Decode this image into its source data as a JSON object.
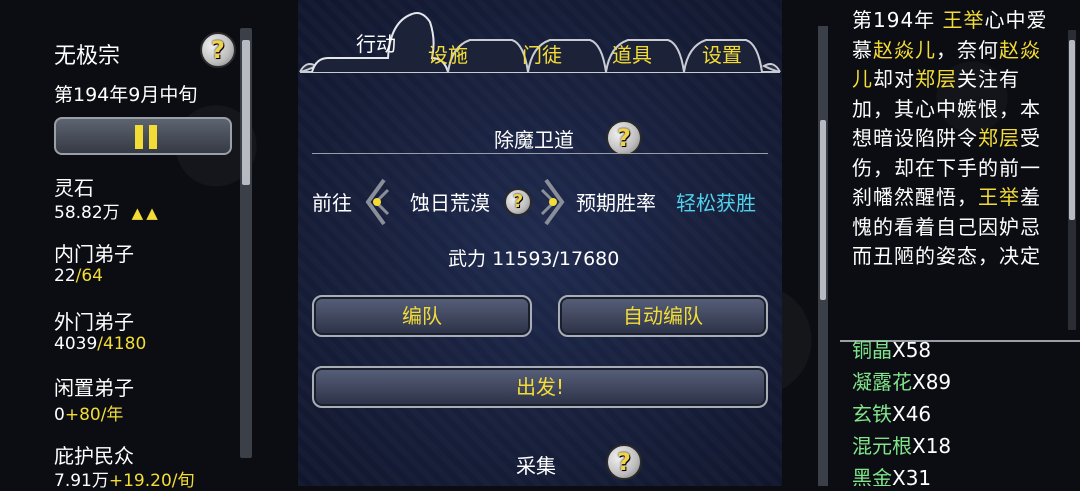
{
  "sect": {
    "name": "无极宗",
    "date": "第194年9月中旬"
  },
  "help_glyph": "?",
  "stats": {
    "spirit_stones": {
      "label": "灵石",
      "value": "58.82万",
      "trend": "▲▲"
    },
    "inner_disciples": {
      "label": "内门弟子",
      "current": "22",
      "max": "/64"
    },
    "outer_disciples": {
      "label": "外门弟子",
      "current": "4039",
      "max": "/4180"
    },
    "idle_disciples": {
      "label": "闲置弟子",
      "current": "0",
      "rate": "+80/年"
    },
    "protected_people": {
      "label": "庇护民众",
      "current": "7.91万",
      "rate": "+19.20/旬"
    }
  },
  "tabs": [
    {
      "label": "行动",
      "active": true
    },
    {
      "label": "设施",
      "active": false
    },
    {
      "label": "门徒",
      "active": false
    },
    {
      "label": "道具",
      "active": false
    },
    {
      "label": "设置",
      "active": false
    }
  ],
  "action": {
    "title": "除魔卫道",
    "goto_label": "前往",
    "location": "蚀日荒漠",
    "win_rate_label": "预期胜率",
    "win_rate_value": "轻松获胜",
    "force_label": "武力",
    "force_value": "11593/17680",
    "team_button": "编队",
    "auto_team_button": "自动编队",
    "depart_button": "出发!",
    "gather_title": "采集"
  },
  "story": [
    {
      "text": "第194年 ",
      "hl": false
    },
    {
      "text": "王举",
      "hl": true
    },
    {
      "text": "心中爱慕",
      "hl": false
    },
    {
      "text": "赵焱儿",
      "hl": true
    },
    {
      "text": "，奈何",
      "hl": false
    },
    {
      "text": "赵焱儿",
      "hl": true
    },
    {
      "text": "却对",
      "hl": false
    },
    {
      "text": "郑层",
      "hl": true
    },
    {
      "text": "关注有加，其心中嫉恨，本想暗设陷阱令",
      "hl": false
    },
    {
      "text": "郑层",
      "hl": true
    },
    {
      "text": "受伤，却在下手的前一刹幡然醒悟，",
      "hl": false
    },
    {
      "text": "王举",
      "hl": true
    },
    {
      "text": "羞愧的看着自己因妒忌而丑陋的姿态，决定",
      "hl": false
    }
  ],
  "inventory": [
    {
      "name": "铜晶",
      "qty": "X58"
    },
    {
      "name": "凝露花",
      "qty": "X89"
    },
    {
      "name": "玄铁",
      "qty": "X46"
    },
    {
      "name": "混元根",
      "qty": "X18"
    },
    {
      "name": "黑金",
      "qty": "X31"
    }
  ],
  "colors": {
    "accent_yellow": "#f3dc36",
    "cyan": "#4fd2ea",
    "item_green": "#7fe48a",
    "panel_blue": "#1b2444"
  }
}
